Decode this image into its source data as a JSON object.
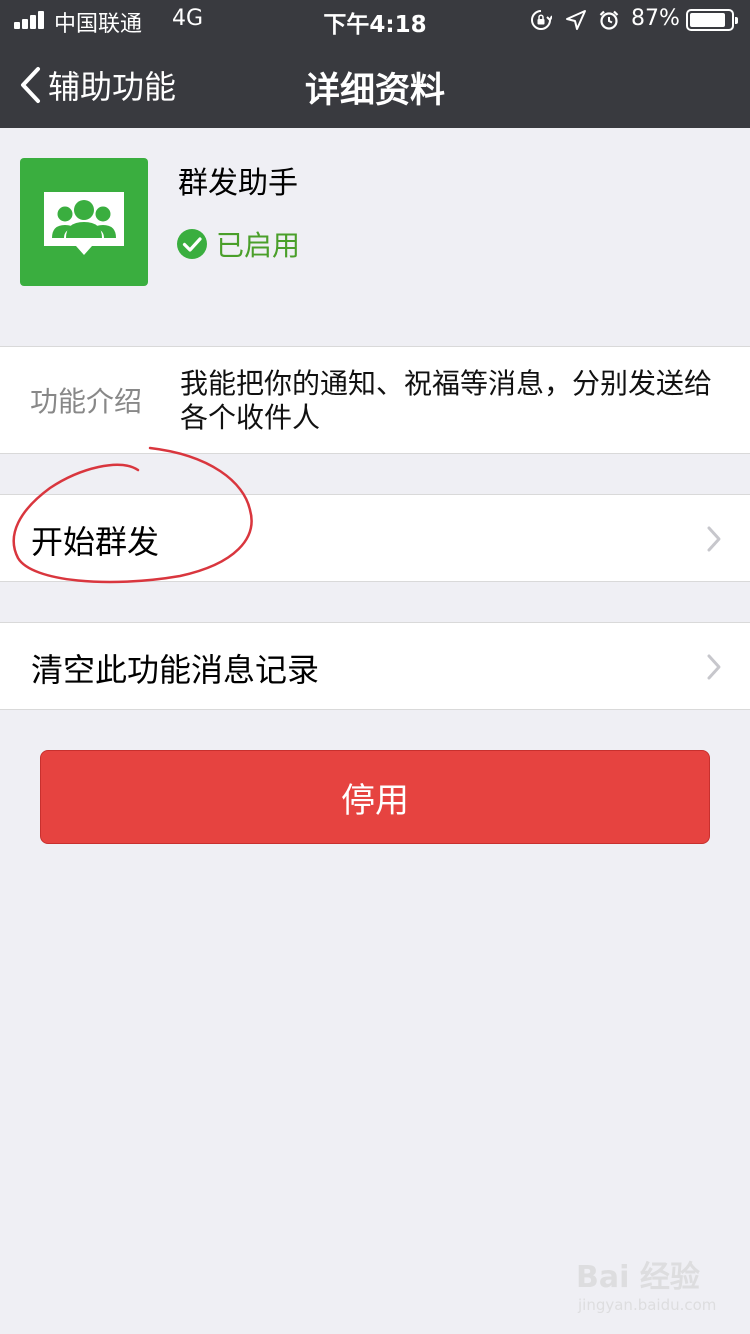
{
  "status_bar": {
    "carrier": "中国联通",
    "network": "4G",
    "time": "下午4:18",
    "battery_percent": "87%",
    "battery_level": 0.87,
    "icons": [
      "rotation-lock-icon",
      "location-arrow-icon",
      "alarm-icon",
      "battery-icon"
    ]
  },
  "nav": {
    "back_label": "辅助功能",
    "title": "详细资料",
    "back_icon": "chevron-left-icon"
  },
  "plugin": {
    "name": "群发助手",
    "status": "已启用",
    "icon": "group-chat-icon",
    "status_icon": "check-circle-icon",
    "accent_color": "#3aae3f"
  },
  "intro": {
    "label": "功能介绍",
    "text": "我能把你的通知、祝福等消息，分别发送给各个收件人"
  },
  "cells": [
    {
      "label": "开始群发"
    },
    {
      "label": "清空此功能消息记录"
    }
  ],
  "disable_button": {
    "label": "停用",
    "color": "#e64340"
  },
  "watermark": {
    "main": "Bai 经验",
    "sub": "jingyan.baidu.com"
  }
}
